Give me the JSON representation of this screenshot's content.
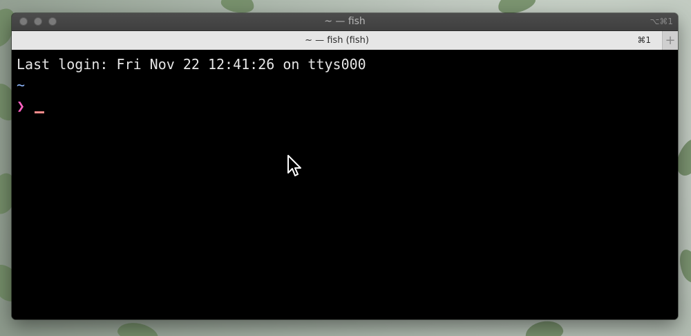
{
  "window": {
    "title": "~ — fish",
    "title_shortcut": "⌥⌘1",
    "tab": {
      "title": "~ — fish (fish)",
      "shortcut": "⌘1"
    },
    "new_tab_symbol": "+"
  },
  "terminal": {
    "login_line": "Last login: Fri Nov 22 12:41:26 on ttys000",
    "cwd_line": "~",
    "prompt_symbol": "❯",
    "colors": {
      "background": "#000000",
      "text": "#e6e6e6",
      "cwd": "#8fb8ff",
      "prompt": "#ff61c2",
      "cursor": "#ff8c8c"
    }
  },
  "icons": {
    "mouse_pointer": "arrow-cursor-icon"
  }
}
